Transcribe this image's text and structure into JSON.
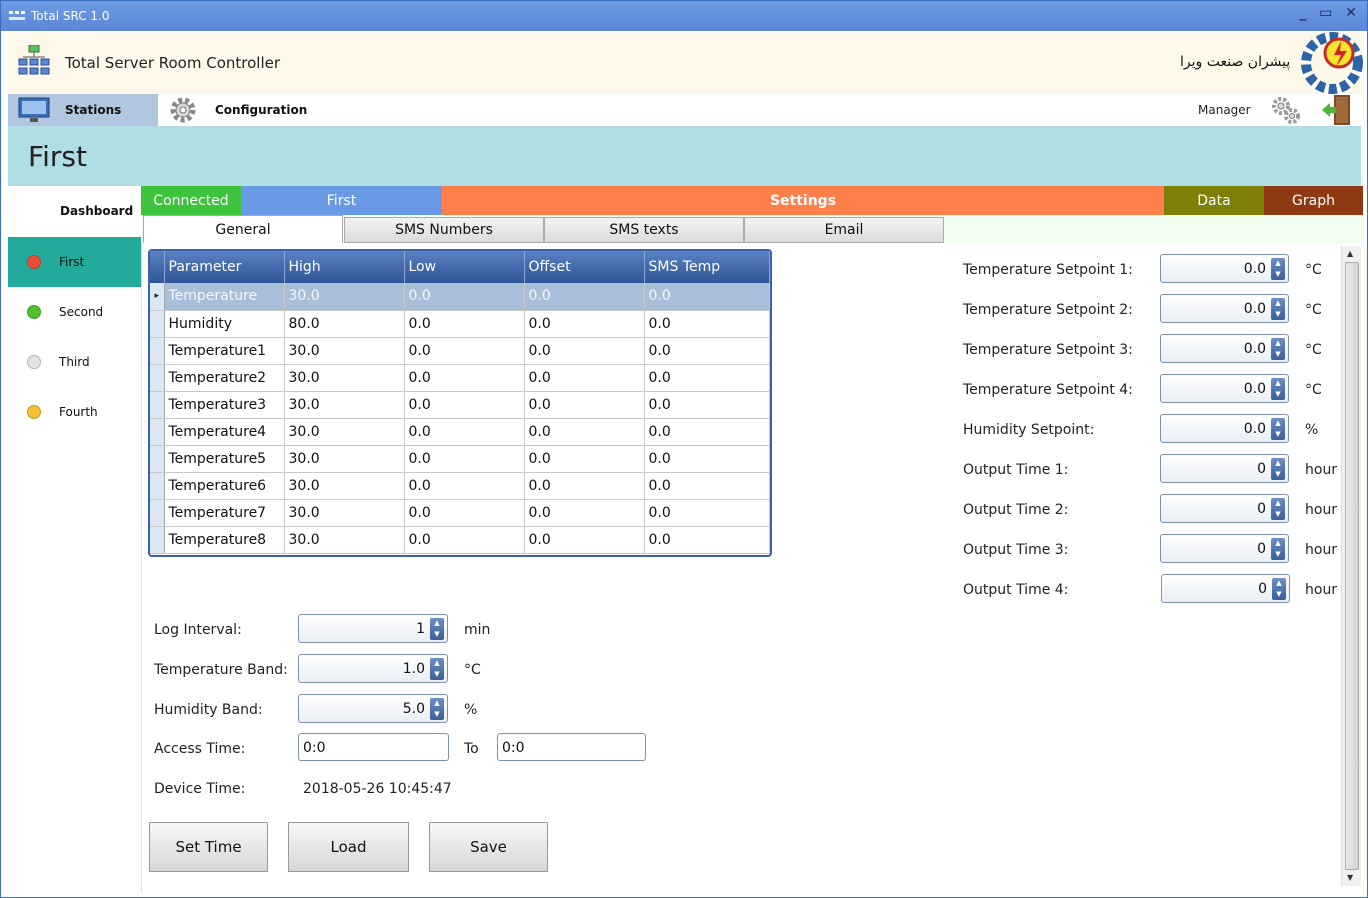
{
  "window": {
    "title": "Total SRC 1.0",
    "controls": "_ ▭ ✕"
  },
  "header": {
    "app_title": "Total Server Room Controller",
    "company": "پیشران صنعت ویرا"
  },
  "menu": {
    "stations": "Stations",
    "configuration": "Configuration",
    "user": "Manager"
  },
  "station": {
    "name": "First"
  },
  "sidebar": {
    "dashboard": "Dashboard",
    "items": [
      {
        "label": "First",
        "color": "#e8503a"
      },
      {
        "label": "Second",
        "color": "#54c02e"
      },
      {
        "label": "Third",
        "color": "#e2e2e2"
      },
      {
        "label": "Fourth",
        "color": "#f5c132"
      }
    ]
  },
  "status": {
    "connected": "Connected",
    "station": "First",
    "page": "Settings",
    "data": "Data",
    "graph": "Graph",
    "colors": {
      "connected": "#3ec33c",
      "station": "#6a99e6",
      "page": "#ff7f4a",
      "data": "#7e7f06",
      "graph": "#8d3a12"
    }
  },
  "tabs": [
    "General",
    "SMS Numbers",
    "SMS texts",
    "Email"
  ],
  "grid": {
    "headers": [
      "Parameter",
      "High",
      "Low",
      "Offset",
      "SMS Temp"
    ],
    "rows": [
      [
        "Temperature",
        "30.0",
        "0.0",
        "0.0",
        "0.0"
      ],
      [
        "Humidity",
        "80.0",
        "0.0",
        "0.0",
        "0.0"
      ],
      [
        "Temperature1",
        "30.0",
        "0.0",
        "0.0",
        "0.0"
      ],
      [
        "Temperature2",
        "30.0",
        "0.0",
        "0.0",
        "0.0"
      ],
      [
        "Temperature3",
        "30.0",
        "0.0",
        "0.0",
        "0.0"
      ],
      [
        "Temperature4",
        "30.0",
        "0.0",
        "0.0",
        "0.0"
      ],
      [
        "Temperature5",
        "30.0",
        "0.0",
        "0.0",
        "0.0"
      ],
      [
        "Temperature6",
        "30.0",
        "0.0",
        "0.0",
        "0.0"
      ],
      [
        "Temperature7",
        "30.0",
        "0.0",
        "0.0",
        "0.0"
      ],
      [
        "Temperature8",
        "30.0",
        "0.0",
        "0.0",
        "0.0"
      ]
    ]
  },
  "settings_left": {
    "log_interval": {
      "label": "Log Interval:",
      "value": "1",
      "unit": "min"
    },
    "temp_band": {
      "label": "Temperature Band:",
      "value": "1.0",
      "unit": "°C"
    },
    "hum_band": {
      "label": "Humidity Band:",
      "value": "5.0",
      "unit": "%"
    },
    "access_time": {
      "label": "Access Time:",
      "from": "0:0",
      "to_label": "To",
      "to": "0:0"
    },
    "device_time": {
      "label": "Device Time:",
      "value": "2018-05-26 10:45:47"
    }
  },
  "buttons": {
    "set_time": "Set Time",
    "load": "Load",
    "save": "Save"
  },
  "setpoints": [
    {
      "label": "Temperature Setpoint 1:",
      "value": "0.0",
      "unit": "°C"
    },
    {
      "label": "Temperature Setpoint 2:",
      "value": "0.0",
      "unit": "°C"
    },
    {
      "label": "Temperature Setpoint 3:",
      "value": "0.0",
      "unit": "°C"
    },
    {
      "label": "Temperature Setpoint 4:",
      "value": "0.0",
      "unit": "°C"
    },
    {
      "label": "Humidity Setpoint:",
      "value": "0.0",
      "unit": "%"
    },
    {
      "label": "Output Time 1:",
      "value": "0",
      "unit": "hour"
    },
    {
      "label": "Output Time 2:",
      "value": "0",
      "unit": "hour"
    },
    {
      "label": "Output Time 3:",
      "value": "0",
      "unit": "hour"
    },
    {
      "label": "Output Time 4:",
      "value": "0",
      "unit": "hour"
    }
  ]
}
